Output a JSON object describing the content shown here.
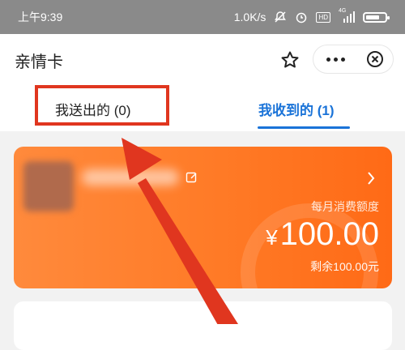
{
  "status_bar": {
    "time": "上午9:39",
    "network_speed": "1.0K/s",
    "signal_label": "4G",
    "hd_label": "HD",
    "icons": [
      "mute-icon",
      "alarm-icon",
      "hd-icon",
      "signal-icon",
      "battery-icon"
    ]
  },
  "header": {
    "title": "亲情卡",
    "icons": [
      "star-icon",
      "more-icon",
      "close-icon"
    ]
  },
  "tabs": [
    {
      "label": "我送出的 (0)",
      "active": false
    },
    {
      "label": "我收到的 (1)",
      "active": true
    }
  ],
  "card": {
    "quota_label": "每月消费额度",
    "currency": "¥",
    "amount": "100.00",
    "remaining": "剩余100.00元",
    "icons": [
      "edit-icon",
      "chevron-right-icon"
    ]
  },
  "colors": {
    "accent_blue": "#1a73d8",
    "card_orange": "#ff7a26",
    "annotation_red": "#e0361f",
    "status_bar_gray": "#8a8a8a"
  }
}
